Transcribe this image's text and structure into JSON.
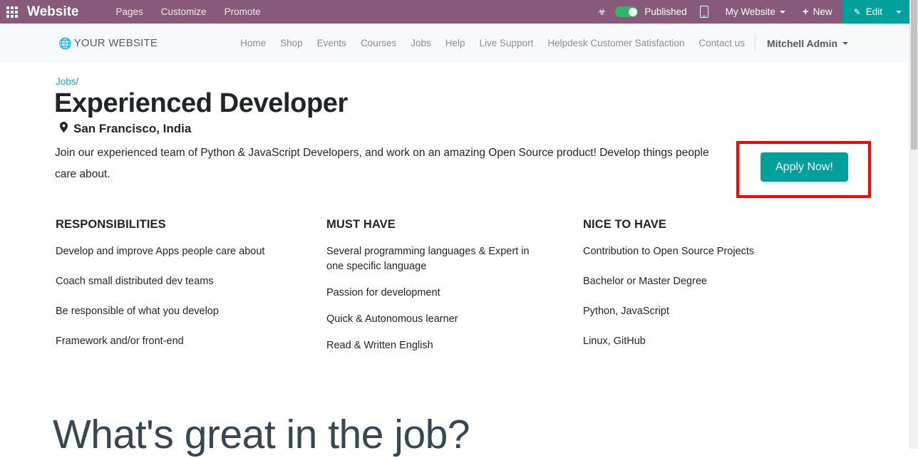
{
  "topbar": {
    "apps_icon": "apps-grid-icon",
    "brand": "Website",
    "menu": [
      {
        "label": "Pages"
      },
      {
        "label": "Customize"
      },
      {
        "label": "Promote"
      }
    ],
    "bug_icon": "☣",
    "published_label": "Published",
    "published_state": "on",
    "mobile_icon": "mobile-preview-icon",
    "site_selector": "My Website",
    "new_label": "New",
    "new_icon": "+",
    "edit_label": "Edit",
    "edit_icon": "✎",
    "colors": {
      "bar": "#875A7B",
      "accent_teal": "#00A09D",
      "toggle_on": "#2EB862"
    }
  },
  "site_nav": {
    "logo_icon": "🌐",
    "logo_text": "YOUR WEBSITE",
    "links": [
      {
        "label": "Home"
      },
      {
        "label": "Shop"
      },
      {
        "label": "Events"
      },
      {
        "label": "Courses"
      },
      {
        "label": "Jobs"
      },
      {
        "label": "Help"
      },
      {
        "label": "Live Support"
      },
      {
        "label": "Helpdesk Customer Satisfaction"
      },
      {
        "label": "Contact us"
      }
    ],
    "user": "Mitchell Admin"
  },
  "page": {
    "breadcrumb_link": "Jobs",
    "breadcrumb_separator": "/",
    "title": "Experienced Developer",
    "location_icon": "📍",
    "location": "San Francisco, India",
    "description": "Join our experienced team of Python & JavaScript Developers, and work on an amazing Open Source product! Develop things people care about.",
    "apply_label": "Apply Now!",
    "highlight_color": "#FF0000",
    "great_heading": "What's great in the job?"
  },
  "columns": [
    {
      "heading": "RESPONSIBILITIES",
      "items": [
        "Develop and improve Apps people care about",
        "Coach small distributed dev teams",
        "Be responsible of what you develop",
        "Framework and/or front-end"
      ]
    },
    {
      "heading": "MUST HAVE",
      "items": [
        "Several programming languages & Expert in one specific language",
        "Passion for development",
        "Quick & Autonomous learner",
        "Read & Written English"
      ]
    },
    {
      "heading": "NICE TO HAVE",
      "items": [
        "Contribution to Open Source Projects",
        "Bachelor or Master Degree",
        "Python, JavaScript",
        "Linux, GitHub"
      ]
    }
  ]
}
